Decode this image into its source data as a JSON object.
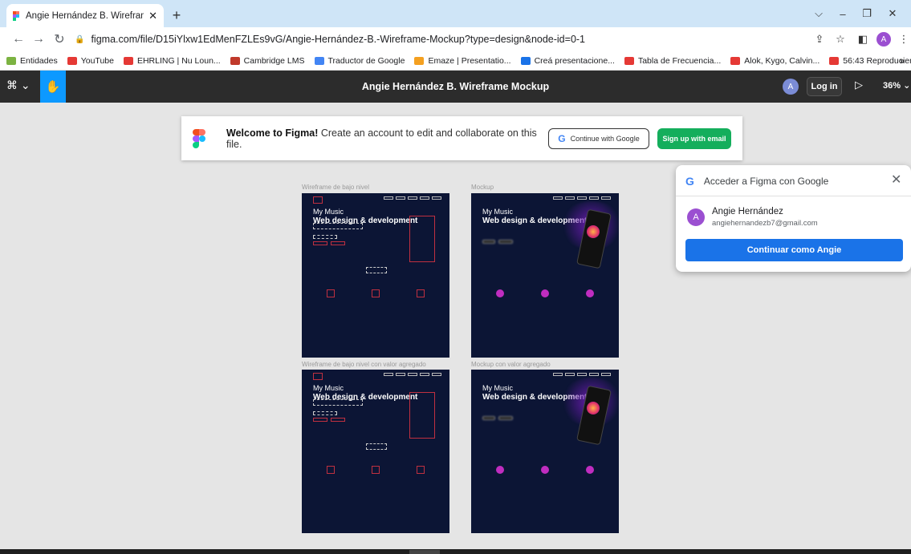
{
  "browser": {
    "tab_title": "Angie Hernández B. Wireframe M",
    "tab_close": "✕",
    "new_tab": "+",
    "url": "figma.com/file/D15iYlxw1EdMenFZLEs9vG/Angie-Hernández-B.-Wireframe-Mockup?type=design&node-id=0-1",
    "profile_initial": "A",
    "bookmarks": [
      {
        "label": "Entidades",
        "color": "#7cb342"
      },
      {
        "label": "YouTube",
        "color": "#e53935"
      },
      {
        "label": "EHRLING | Nu Loun...",
        "color": "#e53935"
      },
      {
        "label": "Cambridge LMS",
        "color": "#c0392b"
      },
      {
        "label": "Traductor de Google",
        "color": "#4285f4"
      },
      {
        "label": "Emaze | Presentatio...",
        "color": "#f4a020"
      },
      {
        "label": "Creá presentacione...",
        "color": "#1a73e8"
      },
      {
        "label": "Tabla de Frecuencia...",
        "color": "#e53935"
      },
      {
        "label": "Alok, Kygo, Calvin...",
        "color": "#e53935"
      },
      {
        "label": "56:43 Reproducien...",
        "color": "#e53935"
      }
    ],
    "bookmarks_more": "»"
  },
  "figma": {
    "file_title": "Angie Hernández B. Wireframe Mockup",
    "user_initial": "A",
    "login_label": "Log in",
    "zoom_label": "36% ⌄",
    "welcome": {
      "bold": "Welcome to Figma!",
      "text": " Create an account to edit and collaborate on this file.",
      "google_label": "Continue with Google",
      "signup_label": "Sign up with email"
    },
    "frames": [
      {
        "label": "Wireframe de bajo nivel",
        "title_small": "My Music",
        "title_big": "Web design & development"
      },
      {
        "label": "Mockup",
        "title_small": "My Music",
        "title_big": "Web design & development"
      },
      {
        "label": "Wireframe de bajo nivel con valor agregado",
        "title_small": "My Music",
        "title_big": "Web design & development"
      },
      {
        "label": "Mockup con valor agregado",
        "title_small": "My Music",
        "title_big": "Web design & development"
      }
    ]
  },
  "google_popup": {
    "title": "Acceder a Figma con Google",
    "account_initial": "A",
    "name": "Angie Hernández",
    "email": "angiehernandezb7@gmail.com",
    "continue_label": "Continuar como Angie"
  }
}
